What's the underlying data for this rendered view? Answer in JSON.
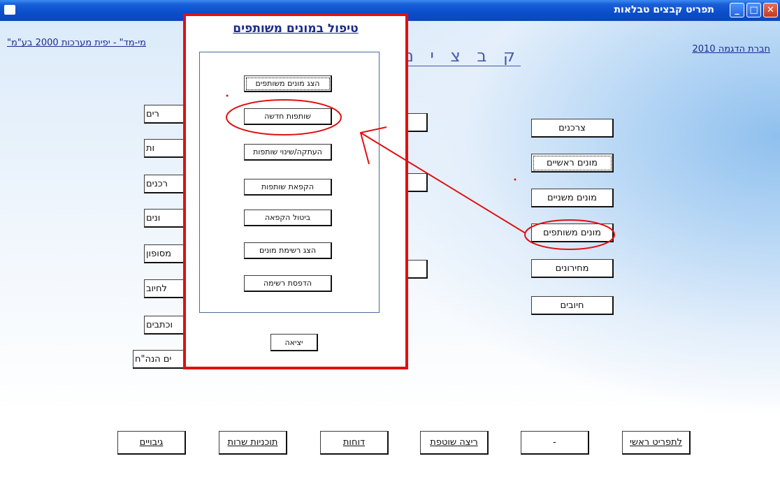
{
  "window": {
    "title": "תפריט קבצים טבלאות"
  },
  "header": {
    "company": "חברת הדגמה 2010",
    "version": "\"מי-מד\" - יפית מערכות 2000 בע\"מ",
    "heading": "ק ב צ י ם"
  },
  "right_menu": {
    "consumers": "צרכנים",
    "main_meters": "מונים ראשיים",
    "secondary_meters": "מונים משניים",
    "shared_meters": "מונים משותפים",
    "prices": "מחירונים",
    "charges": "חיובים"
  },
  "left_menu": {
    "item1": "רים",
    "item2": "ות",
    "item3": "רכנים",
    "item4": "ונים",
    "item5": "מסופון",
    "item6": "לחיוב",
    "item7": "וכתבים",
    "item8": "ים הנה\"ח"
  },
  "bottom_bar": {
    "main_menu": "לתפריט ראשי",
    "dash": "-",
    "continuous_run": "ריצה שוטפת",
    "reports": "דוחות",
    "service_programs": "תוכניות שרות",
    "backups": "גיבויים"
  },
  "dialog": {
    "title": "טיפול במונים משותפים",
    "show_shared": "הצג מונים משותפים",
    "new_partnership": "שותפות חדשה",
    "copy_change": "העתקה/שינוי שותפות",
    "freeze": "הקפאת שותפות",
    "cancel_freeze": "ביטול הקפאה",
    "show_list": "הצג רשימת מונים",
    "print_list": "הדפסת רשימה",
    "exit": "יציאה"
  },
  "annotation": {
    "color": "#e01010"
  }
}
